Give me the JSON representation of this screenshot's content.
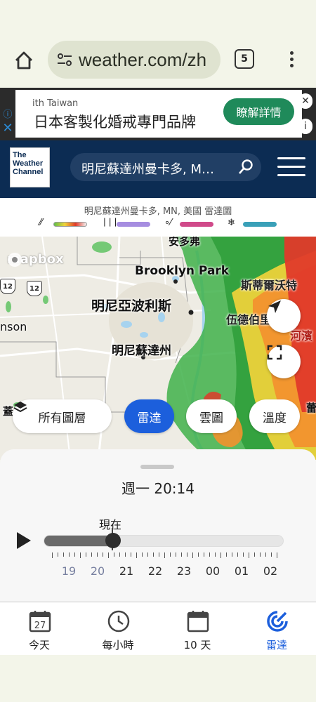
{
  "browser": {
    "url": "weather.com/zh",
    "tab_count": "5"
  },
  "ad": {
    "small_text": "ith Taiwan",
    "title": "日本客製化婚戒專門品牌",
    "cta": "瞭解詳情"
  },
  "header": {
    "logo_lines": [
      "The",
      "Weather",
      "Channel"
    ],
    "search_text": "明尼蘇達州曼卡多, M…"
  },
  "legend": {
    "title": "明尼蘇達州曼卡多, MN, 美國 雷達圖",
    "items": [
      {
        "icon": "rain-icon",
        "colors": [
          "#5fbf4a",
          "#f0d43a",
          "#e03a2a"
        ]
      },
      {
        "icon": "mixed-icon",
        "colors": [
          "#a68de0"
        ]
      },
      {
        "icon": "sleet-icon",
        "colors": [
          "#d04a8a"
        ]
      },
      {
        "icon": "snow-icon",
        "colors": [
          "#3aa0b8"
        ]
      }
    ]
  },
  "map": {
    "attribution": "mapbox",
    "labels": {
      "top": "安多弗",
      "brooklyn_park": "Brooklyn Park",
      "sinbei": "斯蒂爾沃特",
      "minneapolis": "明尼亞波利斯",
      "woodbury": "伍德伯里",
      "hudson": "河濱",
      "st_paul": "明尼蘇達州",
      "left_edge": "nson",
      "bottom_left": "蓋",
      "bottom_right": "蕾"
    },
    "shields": [
      "12",
      "12"
    ],
    "layers": [
      {
        "label": "所有圖層",
        "active": false
      },
      {
        "label": "雷達",
        "active": true
      },
      {
        "label": "雲圖",
        "active": false
      },
      {
        "label": "溫度",
        "active": false
      }
    ]
  },
  "timeline": {
    "current_time": "週一 20:14",
    "now_label": "現在",
    "progress": 0.26,
    "hours": [
      "19",
      "20",
      "21",
      "22",
      "23",
      "00",
      "01",
      "02"
    ],
    "past_count": 2
  },
  "nav": {
    "items": [
      {
        "label": "今天",
        "icon": "calendar-day-icon",
        "day": "27",
        "active": false
      },
      {
        "label": "每小時",
        "icon": "clock-icon",
        "active": false
      },
      {
        "label": "10 天",
        "icon": "calendar-icon",
        "active": false
      },
      {
        "label": "雷達",
        "icon": "radar-icon",
        "active": true
      }
    ]
  }
}
